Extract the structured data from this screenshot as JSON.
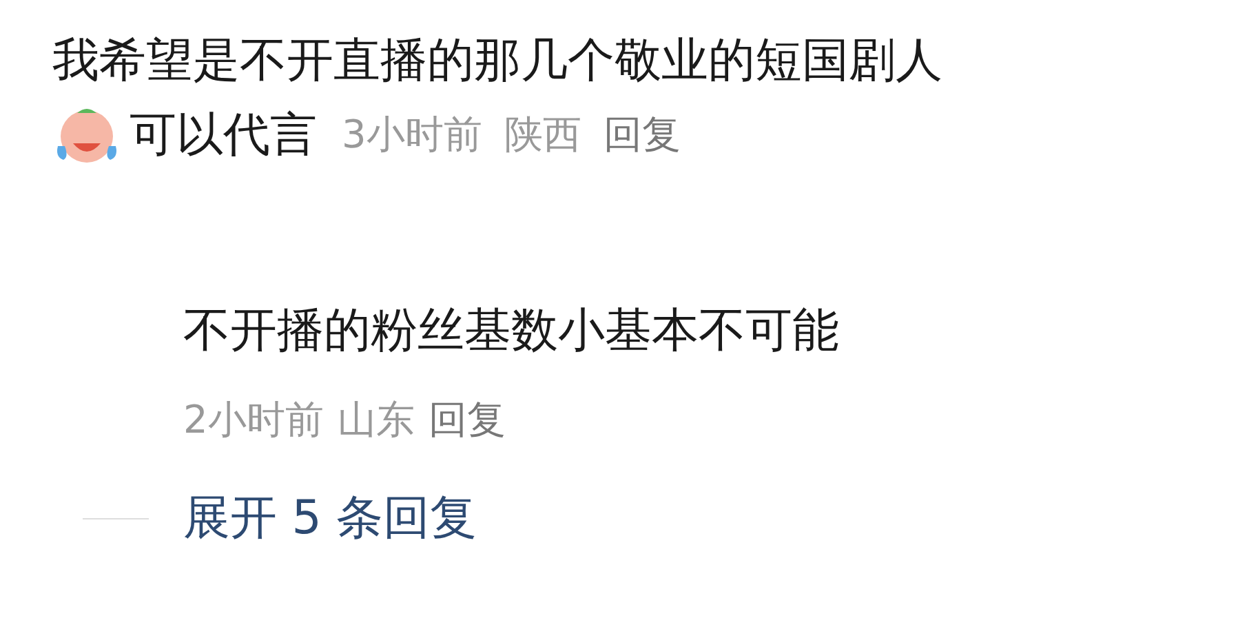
{
  "comment": {
    "text_before_emoji": "我希望是不开直播的那几个敬业的短国剧人",
    "text_after_emoji": "可以代言",
    "time": "3小时前",
    "location": "陕西",
    "reply_link": "回复"
  },
  "reply": {
    "text": "不开播的粉丝基数小基本不可能",
    "time": "2小时前",
    "location": "山东",
    "reply_link": "回复"
  },
  "expand_replies": "展开 5 条回复"
}
